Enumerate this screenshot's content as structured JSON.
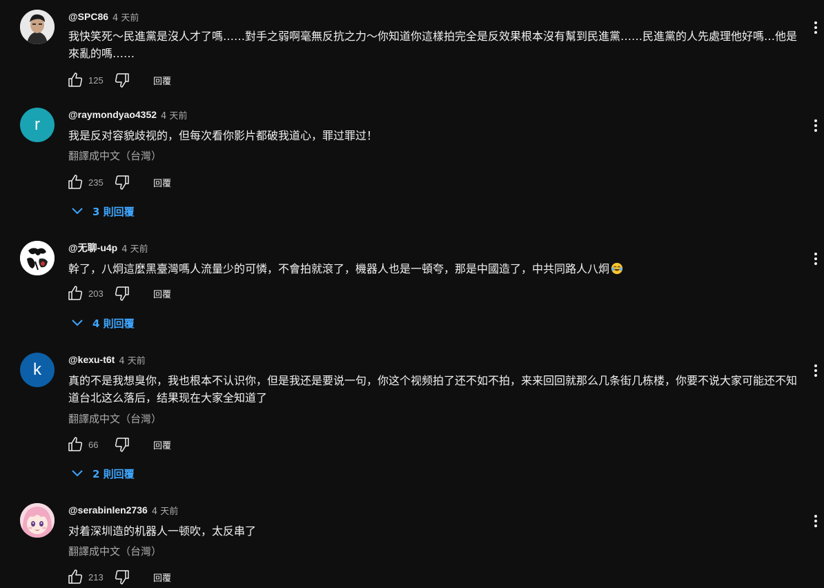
{
  "comments": [
    {
      "author": "@SPC86",
      "time": "4 天前",
      "text": "我快笑死～民進黨是沒人才了嗎……對手之弱啊毫無反抗之力～你知道你這樣拍完全是反效果根本沒有幫到民進黨……民進黨的人先處理他好嗎…他是來亂的嗎……",
      "likes": "125",
      "reply_label": "回覆",
      "avatar": "photo"
    },
    {
      "author": "@raymondyao4352",
      "time": "4 天前",
      "text": "我是反对容貌歧视的，但每次看你影片都破我道心，罪过罪过！",
      "translate": "翻譯成中文（台灣）",
      "likes": "235",
      "reply_label": "回覆",
      "replies_label": "3 則回覆",
      "avatar_letter": "r",
      "avatar_color": "#1aa3b3"
    },
    {
      "author": "@无聊-u4p",
      "time": "4 天前",
      "text": "幹了，八炯這麼黑臺灣嗎人流量少的可憐，不會拍就滾了，機器人也是一頓夸，那是中國造了，中共同路人八炯",
      "emoji": "laughing-tears-emoji",
      "likes": "203",
      "reply_label": "回覆",
      "replies_label": "4 則回覆",
      "avatar": "ink-drawing"
    },
    {
      "author": "@kexu-t6t",
      "time": "4 天前",
      "text": "真的不是我想臭你，我也根本不认识你，但是我还是要说一句，你这个视频拍了还不如不拍，来来回回就那么几条街几栋楼，你要不说大家可能还不知道台北这么落后，结果现在大家全知道了",
      "translate": "翻譯成中文（台灣）",
      "likes": "66",
      "reply_label": "回覆",
      "replies_label": "2 則回覆",
      "avatar_letter": "k",
      "avatar_color": "#0d5fa8"
    },
    {
      "author": "@serabinlen2736",
      "time": "4 天前",
      "text": "对着深圳造的机器人一顿吹，太反串了",
      "translate": "翻譯成中文（台灣）",
      "likes": "213",
      "reply_label": "回覆",
      "avatar": "anime-girl"
    }
  ],
  "colors": {
    "background": "#0f0f0f",
    "text": "#f1f1f1",
    "secondary": "#aaaaaa",
    "link": "#3ea6ff"
  }
}
